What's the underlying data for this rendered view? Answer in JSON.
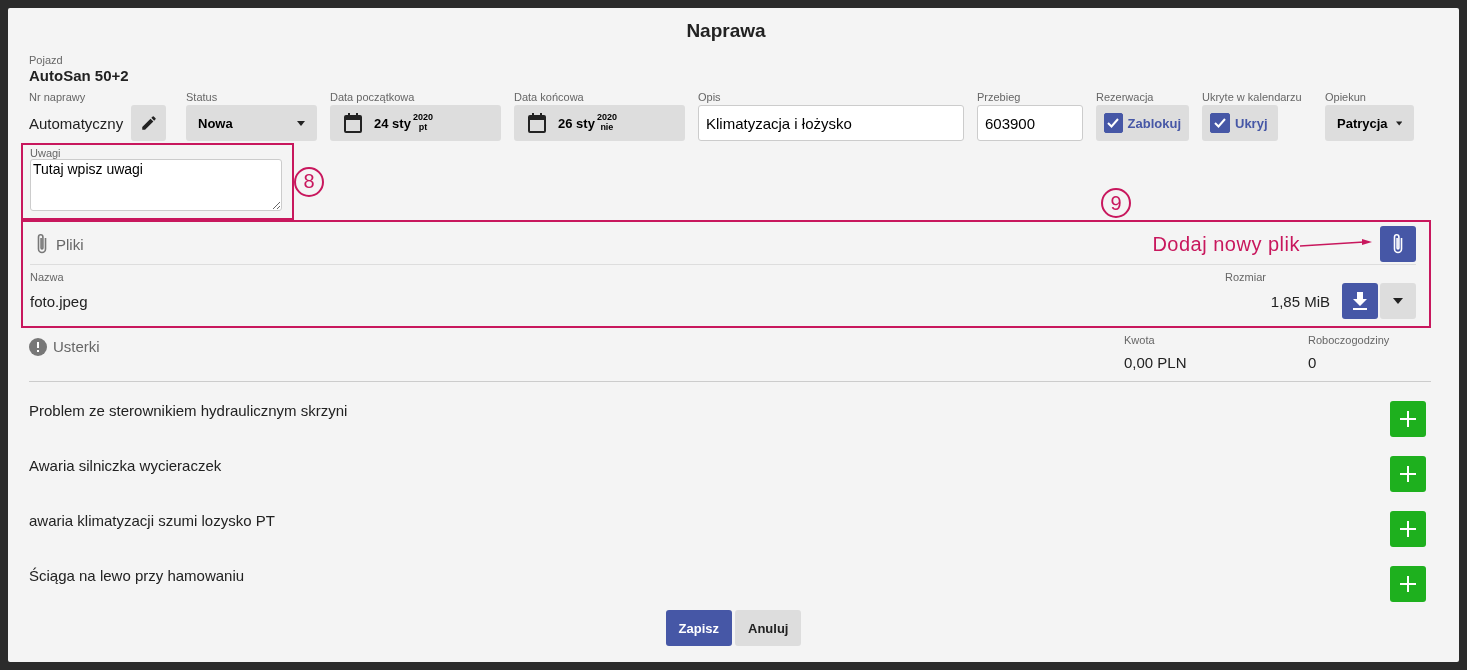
{
  "dialog": {
    "title": "Naprawa"
  },
  "vehicle": {
    "label": "Pojazd",
    "value": "AutoSan 50+2"
  },
  "fields": [
    {
      "kind": "text-edit",
      "label": "Nr naprawy",
      "value": "Automatyczny"
    },
    {
      "kind": "select",
      "label": "Status",
      "value": "Nowa"
    },
    {
      "kind": "date",
      "label": "Data początkowa",
      "day": "24 sty",
      "year": "2020",
      "weekday": "pt"
    },
    {
      "kind": "date",
      "label": "Data końcowa",
      "day": "26 sty",
      "year": "2020",
      "weekday": "nie"
    },
    {
      "kind": "input",
      "label": "Opis",
      "value": "Klimatyzacja i łożysko"
    },
    {
      "kind": "input",
      "label": "Przebieg",
      "value": "603900"
    },
    {
      "kind": "checkbox",
      "label": "Rezerwacja",
      "text": "Zablokuj",
      "checked": true
    },
    {
      "kind": "checkbox",
      "label": "Ukryte w kalendarzu",
      "text": "Ukryj",
      "checked": true
    },
    {
      "kind": "select",
      "label": "Opiekun",
      "value": "Patrycja"
    }
  ],
  "notes": {
    "label": "Uwagi",
    "value": "Tutaj wpisz uwagi"
  },
  "files": {
    "title": "Pliki",
    "columns": [
      "Nazwa",
      "Rozmiar"
    ],
    "rows": [
      {
        "name": "foto.jpeg",
        "size": "1,85 MiB"
      }
    ]
  },
  "faults": {
    "title": "Usterki",
    "summary": [
      {
        "label": "Kwota",
        "value": "0,00 PLN"
      },
      {
        "label": "Roboczogodziny",
        "value": "0"
      }
    ],
    "items": [
      "Problem ze sterownikiem hydraulicznym skrzyni",
      "Awaria silniczka wycieraczek",
      "awaria klimatyzacji szumi lozysko PT",
      "Ściąga na lewo przy hamowaniu"
    ]
  },
  "annotations": [
    {
      "number": "8"
    },
    {
      "number": "9",
      "callout": "Dodaj nowy plik"
    }
  ],
  "buttons": [
    {
      "kind": "primary",
      "label": "Zapisz"
    },
    {
      "kind": "secondary",
      "label": "Anuluj"
    }
  ]
}
